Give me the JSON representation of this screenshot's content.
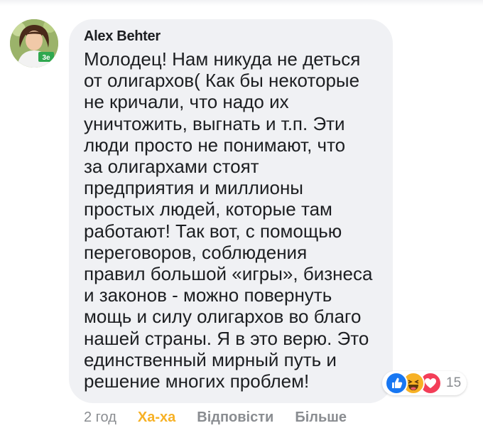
{
  "comment": {
    "author": "Alex Behter",
    "text": "Молодец! Нам никуда не деться\nот олигархов( Как бы некоторые\nне кричали, что надо их\nуничтожить, выгнать и т.п. Эти\nлюди просто не понимают, что\nза олигархами стоят\nпредприятия и миллионы\nпростых людей, которые там\nработают! Так вот, с помощью\nпереговоров, соблюдения\nправил большой «игры», бизнеса\nи законов - можно повернуть\nмощь и силу олигархов во благо\nнашей страны. Я в это верю. Это\nединственный мирный путь и\nрешение многих проблем!",
    "avatar_badge": "3e"
  },
  "reactions": {
    "icons": [
      "like-icon",
      "haha-icon",
      "love-icon"
    ],
    "count": "15"
  },
  "actions": {
    "time": "2 год",
    "reaction": "Ха-ха",
    "reply": "Відповісти",
    "more": "Більше"
  },
  "colors": {
    "bubble": "#f0f1f4",
    "text": "#1c1e21",
    "muted": "#8a8d91",
    "haha": "#f7b125",
    "like": "#1877f2",
    "love": "#f33e58"
  }
}
